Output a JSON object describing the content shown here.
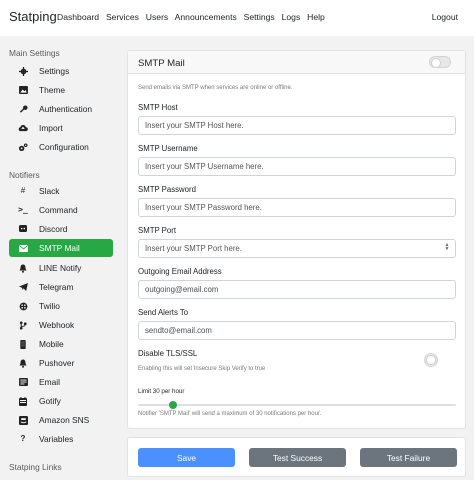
{
  "nav": {
    "brand": "Statping",
    "links": [
      "Dashboard",
      "Services",
      "Users",
      "Announcements",
      "Settings",
      "Logs",
      "Help"
    ],
    "logout": "Logout"
  },
  "sidebar": {
    "main_title": "Main Settings",
    "main_items": [
      {
        "label": "Settings",
        "icon": "gear-icon"
      },
      {
        "label": "Theme",
        "icon": "image-icon"
      },
      {
        "label": "Authentication",
        "icon": "key-icon"
      },
      {
        "label": "Import",
        "icon": "cloud-upload-icon"
      },
      {
        "label": "Configuration",
        "icon": "cogs-icon"
      }
    ],
    "notifiers_title": "Notifiers",
    "notifier_items": [
      {
        "label": "Slack",
        "icon": "slack-icon"
      },
      {
        "label": "Command",
        "icon": "terminal-icon"
      },
      {
        "label": "Discord",
        "icon": "discord-icon"
      },
      {
        "label": "SMTP Mail",
        "icon": "envelope-icon",
        "active": true
      },
      {
        "label": "LINE Notify",
        "icon": "bell-icon"
      },
      {
        "label": "Telegram",
        "icon": "telegram-icon"
      },
      {
        "label": "Twilio",
        "icon": "twilio-icon"
      },
      {
        "label": "Webhook",
        "icon": "webhook-icon"
      },
      {
        "label": "Mobile",
        "icon": "mobile-icon"
      },
      {
        "label": "Pushover",
        "icon": "pushover-icon"
      },
      {
        "label": "Email",
        "icon": "mail-icon"
      },
      {
        "label": "Gotify",
        "icon": "gotify-icon"
      },
      {
        "label": "Amazon SNS",
        "icon": "aws-icon"
      },
      {
        "label": "Variables",
        "icon": "question-icon"
      }
    ],
    "links_title": "Statping Links"
  },
  "form": {
    "title": "SMTP Mail",
    "enabled": false,
    "description": "Send emails via SMTP when services are online or offline.",
    "fields": [
      {
        "label": "SMTP Host",
        "placeholder": "Insert your SMTP Host here.",
        "value": ""
      },
      {
        "label": "SMTP Username",
        "placeholder": "Insert your SMTP Username here.",
        "value": ""
      },
      {
        "label": "SMTP Password",
        "placeholder": "Insert your SMTP Password here.",
        "value": ""
      },
      {
        "label": "SMTP Port",
        "placeholder": "Insert your SMTP Port here.",
        "value": ""
      },
      {
        "label": "Outgoing Email Address",
        "placeholder": "",
        "value": "outgoing@email.com"
      },
      {
        "label": "Send Alerts To",
        "placeholder": "",
        "value": "sendto@email.com"
      }
    ],
    "tls_label": "Disable TLS/SSL",
    "tls_enabled": false,
    "tls_hint": "Enabling this will set Insecure Skip Verify to true",
    "limit_label": "Limit 30 per hour",
    "limit_value": 30,
    "limit_fraction": 0.11,
    "limit_hint": "Notifier 'SMTP Mail' will send a maximum of 30 notifications per hour."
  },
  "actions": {
    "save": "Save",
    "test_success": "Test Success",
    "test_failure": "Test Failure"
  },
  "colors": {
    "active_green": "#28a745",
    "save_blue": "#4a90ff",
    "test_gray": "#6c757d"
  }
}
